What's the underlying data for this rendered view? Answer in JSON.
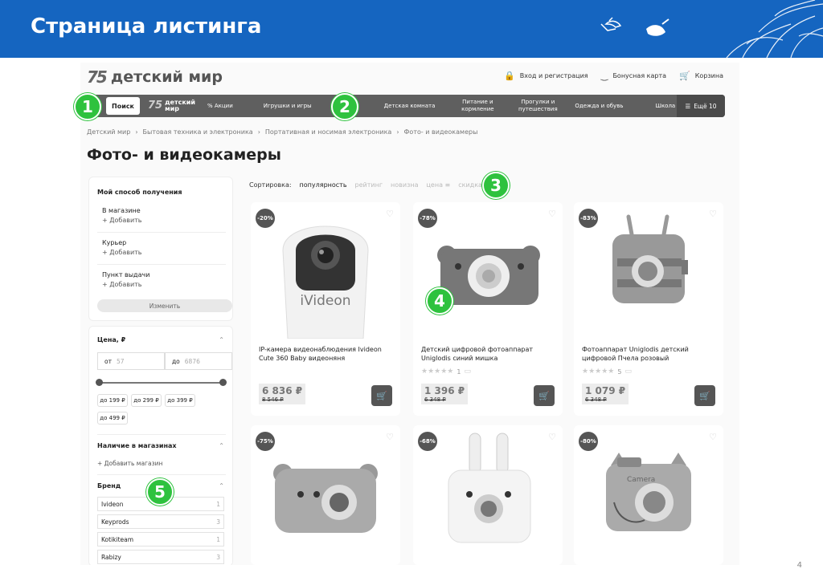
{
  "slide": {
    "title": "Страница листинга",
    "page_number": "4"
  },
  "site": {
    "logo": {
      "number": "75",
      "text": "детский мир"
    },
    "top_links": [
      {
        "label": "Вход и регистрация",
        "icon": "lock-icon"
      },
      {
        "label": "Бонусная карта",
        "icon": "smile-icon"
      },
      {
        "label": "Корзина",
        "icon": "cart-icon"
      }
    ],
    "nav": {
      "search": "Поиск",
      "logo_line1": "детский",
      "logo_line2": "мир",
      "items": [
        "Акции",
        "Игрушки и игры",
        "Детская комната",
        "Питание и кормление",
        "Прогулки и путешествия",
        "Одежда и обувь",
        "Школа"
      ],
      "more": "Ещё 10"
    },
    "breadcrumbs": [
      "Детский мир",
      "Бытовая техника и электроника",
      "Портативная и носимая электроника",
      "Фото- и видеокамеры"
    ],
    "page_title": "Фото- и видеокамеры",
    "sort": {
      "label": "Сортировка:",
      "options": [
        "популярность",
        "рейтинг",
        "новизна",
        "цена",
        "скидка"
      ]
    },
    "delivery": {
      "title": "Мой способ получения",
      "options": [
        "В магазине",
        "Курьер",
        "Пункт выдачи"
      ],
      "add_label": "+ Добавить",
      "change_button": "Изменить"
    },
    "filters": {
      "price_title": "Цена, ₽",
      "from_label": "от",
      "from_placeholder": "57",
      "to_label": "до",
      "to_placeholder": "6876",
      "chips": [
        "до 199 ₽",
        "до 299 ₽",
        "до 399 ₽",
        "до 499 ₽"
      ],
      "availability_title": "Наличие в магазинах",
      "add_store": "+ Добавить магазин",
      "brand_title": "Бренд",
      "brands": [
        {
          "name": "Ivideon",
          "count": "1"
        },
        {
          "name": "Keyprods",
          "count": "3"
        },
        {
          "name": "Kotikiteam",
          "count": "1"
        },
        {
          "name": "Rabizy",
          "count": "3"
        }
      ]
    },
    "products": [
      {
        "discount": "-20%",
        "name": "IP-камера видеонаблюдения Ivideon Cute 360 Baby видеоняня",
        "price": "6 836 ₽",
        "old_price": "8 546 ₽",
        "rating_count": ""
      },
      {
        "discount": "-78%",
        "name": "Детский цифровой фотоаппарат Uniglodis синий мишка",
        "price": "1 396 ₽",
        "old_price": "6 348 ₽",
        "rating_count": "1"
      },
      {
        "discount": "-83%",
        "name": "Фотоаппарат Uniglodis детский цифровой Пчела розовый",
        "price": "1 079 ₽",
        "old_price": "6 348 ₽",
        "rating_count": "5"
      },
      {
        "discount": "-75%"
      },
      {
        "discount": "-68%"
      },
      {
        "discount": "-80%"
      }
    ],
    "camera_brand_text": "iVideon",
    "camera6_text": "Camera"
  },
  "markers": [
    "1",
    "2",
    "3",
    "4",
    "5"
  ],
  "colors": {
    "header_blue": "#1565c0",
    "marker_green": "#2ec23e",
    "nav_gray": "#5f5f5f"
  }
}
